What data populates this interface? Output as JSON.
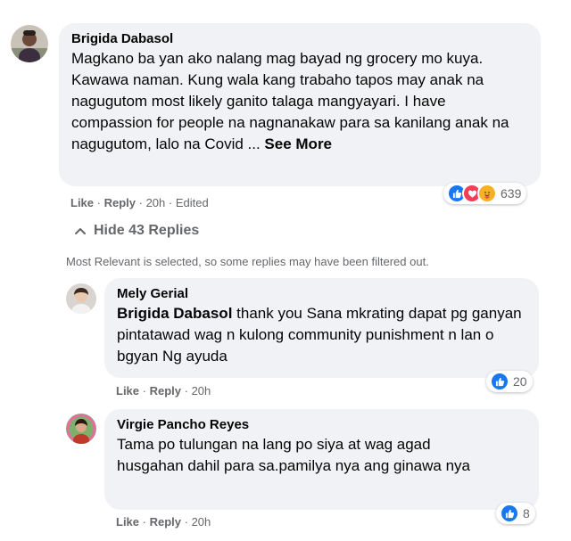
{
  "comment": {
    "author": "Brigida Dabasol",
    "text": "Magkano ba yan ako nalang mag bayad ng grocery mo kuya. Kawawa naman. Kung wala kang trabaho tapos may anak na nagugutom most likely ganito talaga mangyayari. I have compassion for people na nagnanakaw para sa kanilang anak na nagugutom, lalo na Covid ...",
    "see_more": "See More",
    "like": "Like",
    "reply": "Reply",
    "meta": "20h · Edited",
    "reaction_count": "639",
    "reaction_icons": [
      "like-icon",
      "love-icon",
      "care-icon"
    ]
  },
  "hide_replies": "Hide 43 Replies",
  "filter_note": "Most Relevant is selected, so some replies may have been filtered out.",
  "replies": [
    {
      "author": "Mely Gerial",
      "mention": "Brigida Dabasol",
      "text": "thank you Sana mkrating dapat pg ganyan pintatawad wag n kulong community punishment n lan o bgyan Ng ayuda",
      "like": "Like",
      "reply": "Reply",
      "meta": "20h",
      "reaction_count": "20",
      "reaction_icons": [
        "like-icon"
      ]
    },
    {
      "author": "Virgie Pancho Reyes",
      "text": "Tama po tulungan na lang po siya at wag agad husgahan dahil para sa.pamilya nya ang ginawa nya",
      "like": "Like",
      "reply": "Reply",
      "meta": "20h",
      "reaction_count": "8",
      "reaction_icons": [
        "like-icon"
      ]
    }
  ],
  "colors": {
    "bubble": "#f0f2f5",
    "like_blue": "#1877f2",
    "love_red": "#f33e58",
    "secondary_text": "#65676b"
  }
}
